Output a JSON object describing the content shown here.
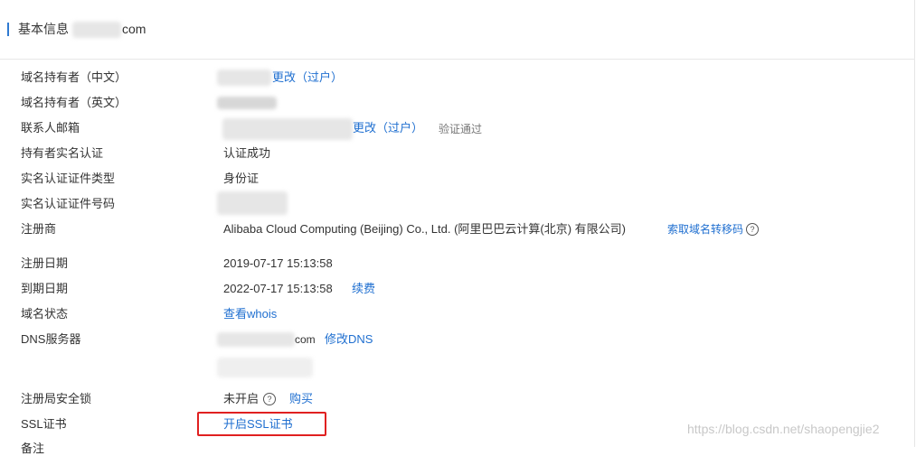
{
  "header": {
    "title": "基本信息",
    "domain_suffix": "com"
  },
  "rows": {
    "owner_cn": {
      "label": "域名持有者（中文）",
      "action": "更改（过户）"
    },
    "owner_en": {
      "label": "域名持有者（英文）"
    },
    "email": {
      "label": "联系人邮箱",
      "action": "更改（过户）",
      "status": "验证通过"
    },
    "realname": {
      "label": "持有者实名认证",
      "value": "认证成功"
    },
    "cert_type": {
      "label": "实名认证证件类型",
      "value": "身份证"
    },
    "cert_number": {
      "label": "实名认证证件号码"
    },
    "registrar": {
      "label": "注册商",
      "value": "Alibaba Cloud Computing (Beijing) Co., Ltd. (阿里巴巴云计算(北京) 有限公司)",
      "action": "索取域名转移码",
      "help_icon": "?"
    },
    "reg_date": {
      "label": "注册日期",
      "value": "2019-07-17 15:13:58"
    },
    "exp_date": {
      "label": "到期日期",
      "value": "2022-07-17 15:13:58",
      "action": "续费"
    },
    "status": {
      "label": "域名状态",
      "action": "查看whois"
    },
    "dns": {
      "label": "DNS服务器",
      "value_suffix": "com",
      "action": "修改DNS"
    },
    "lock": {
      "label": "注册局安全锁",
      "value": "未开启",
      "help_icon": "?",
      "action": "购买"
    },
    "ssl": {
      "label": "SSL证书",
      "action": "开启SSL证书"
    },
    "note": {
      "label": "备注"
    }
  },
  "watermark": "https://blog.csdn.net/shaopengjie2",
  "colors": {
    "link": "#1f6fd0",
    "highlight": "#e02020",
    "accent_bar": "#2f7ad1"
  }
}
